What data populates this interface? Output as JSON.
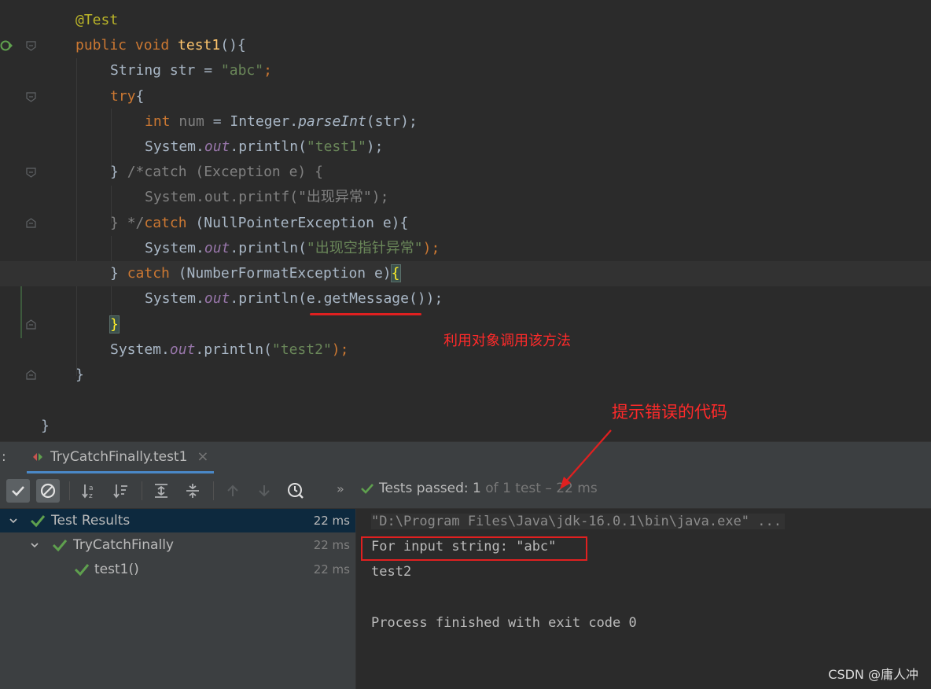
{
  "editor": {
    "lines": {
      "l1": {
        "ann": "@Test"
      },
      "l2": {
        "kw": "public void ",
        "fn": "test1",
        "rest": "(){"
      },
      "l3": {
        "a": "String str = ",
        "str": "\"abc\"",
        "semi": ";"
      },
      "l4": {
        "kw": "try",
        "rest": "{"
      },
      "l5": {
        "kw": "int ",
        "var": "num",
        "a": " = Integer.",
        "method": "parseInt",
        "rest": "(str);"
      },
      "l6": {
        "a": "System.",
        "field": "out",
        "b": ".println(",
        "str": "\"test1\"",
        "rest": ");"
      },
      "l7": {
        "a": "} ",
        "cmt": "/*catch (Exception e) {"
      },
      "l8": {
        "cmt": "System.out.printf(\"出现异常\");"
      },
      "l9": {
        "a": "} ",
        "cmt": "*/",
        "kw": "catch ",
        "rest": "(NullPointerException e){"
      },
      "l10": {
        "a": "System.",
        "field": "out",
        "b": ".println(",
        "str": "\"出现空指针异常\"",
        "rest": ");"
      },
      "l11": {
        "a": "} ",
        "kw": "catch ",
        "b": "(NumberFormatException e)",
        "brace": "{"
      },
      "l12": {
        "a": "System.",
        "field": "out",
        "b": ".println(e.getMessage());"
      },
      "l13": {
        "brace": "}"
      },
      "l14": {
        "a": "System.",
        "field": "out",
        "b": ".println(",
        "str": "\"test2\"",
        "rest": ");"
      },
      "l15": {
        "a": "}"
      },
      "l17": {
        "a": "}"
      }
    }
  },
  "annotations": {
    "note1": "利用对象调用该方法",
    "note2": "提示错误的代码"
  },
  "run_panel": {
    "colon": ":",
    "tab_label": "TryCatchFinally.test1",
    "tab_close": "×",
    "more": "»",
    "status": {
      "prefix": "Tests passed: ",
      "count": "1",
      "suffix": " of 1 test – 22 ms"
    },
    "tree": [
      {
        "label": "Test Results",
        "time": "22 ms"
      },
      {
        "label": "TryCatchFinally",
        "time": "22 ms"
      },
      {
        "label": "test1()",
        "time": "22 ms"
      }
    ],
    "console": {
      "cmd": "\"D:\\Program Files\\Java\\jdk-16.0.1\\bin\\java.exe\" ...",
      "line1": "For input string: \"abc\"",
      "line2": "test2",
      "line3": "Process finished with exit code 0"
    }
  },
  "watermark": "CSDN @庸人冲",
  "colors": {
    "accent_green": "#5fa04e",
    "annotation_red": "#e02020",
    "keyword": "#cc7832",
    "string": "#6a8759"
  }
}
